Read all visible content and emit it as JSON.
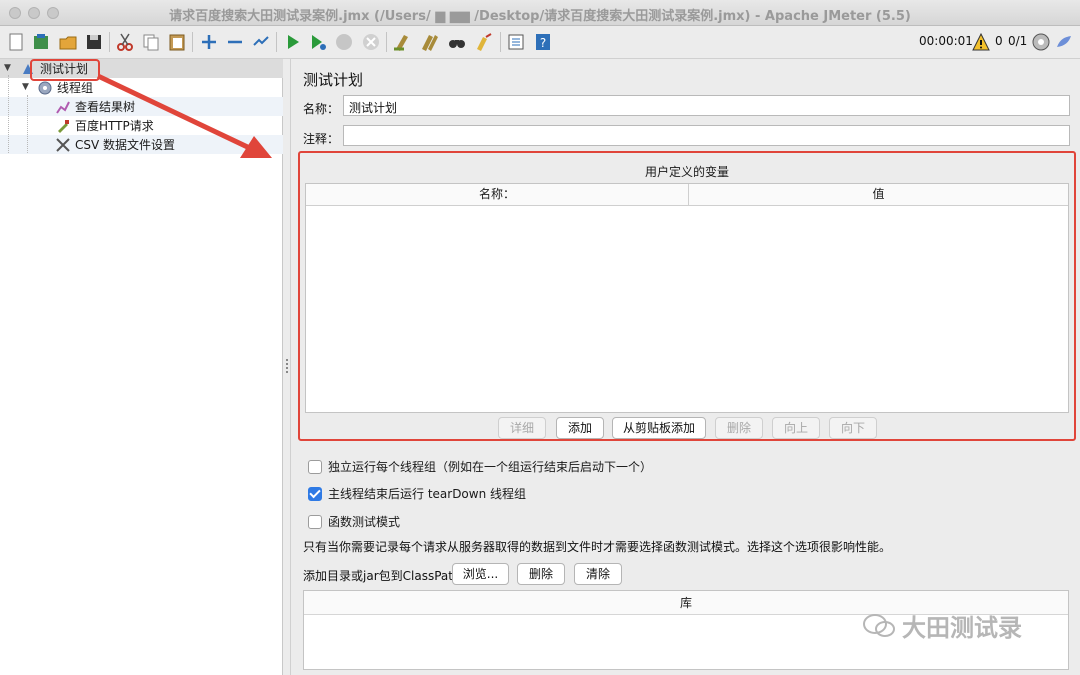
{
  "window": {
    "title": "请求百度搜索大田测试录案例.jmx (/Users/ ▆ ▆▆ /Desktop/请求百度搜索大田测试录案例.jmx) - Apache JMeter (5.5)"
  },
  "toolbar": {
    "timer": "00:00:01",
    "warnings": "0",
    "threads": "0/1"
  },
  "tree": {
    "items": [
      {
        "label": "测试计划"
      },
      {
        "label": "线程组"
      },
      {
        "label": "查看结果树"
      },
      {
        "label": "百度HTTP请求"
      },
      {
        "label": "CSV 数据文件设置"
      }
    ]
  },
  "panel": {
    "title": "测试计划",
    "name_label": "名称：",
    "name_value": "测试计划",
    "comment_label": "注释：",
    "comment_value": "",
    "vars": {
      "title": "用户定义的变量",
      "col_name": "名称：",
      "col_value": "值",
      "buttons": {
        "detail": "详细",
        "add": "添加",
        "add_clipboard": "从剪贴板添加",
        "delete": "删除",
        "up": "向上",
        "down": "向下"
      }
    },
    "options": {
      "independent": "独立运行每个线程组（例如在一个组运行结束后启动下一个）",
      "teardown": "主线程结束后运行 tearDown 线程组",
      "functional": "函数测试模式",
      "functional_note": "只有当你需要记录每个请求从服务器取得的数据到文件时才需要选择函数测试模式。选择这个选项很影响性能。"
    },
    "classpath": {
      "label": "添加目录或jar包到ClassPath",
      "browse": "浏览...",
      "delete": "删除",
      "clear": "清除",
      "lib_header": "库"
    }
  },
  "watermark": {
    "text": "大田测试录"
  },
  "colors": {
    "accent_red": "#e0453a",
    "checkbox_blue": "#2f7ae5"
  }
}
